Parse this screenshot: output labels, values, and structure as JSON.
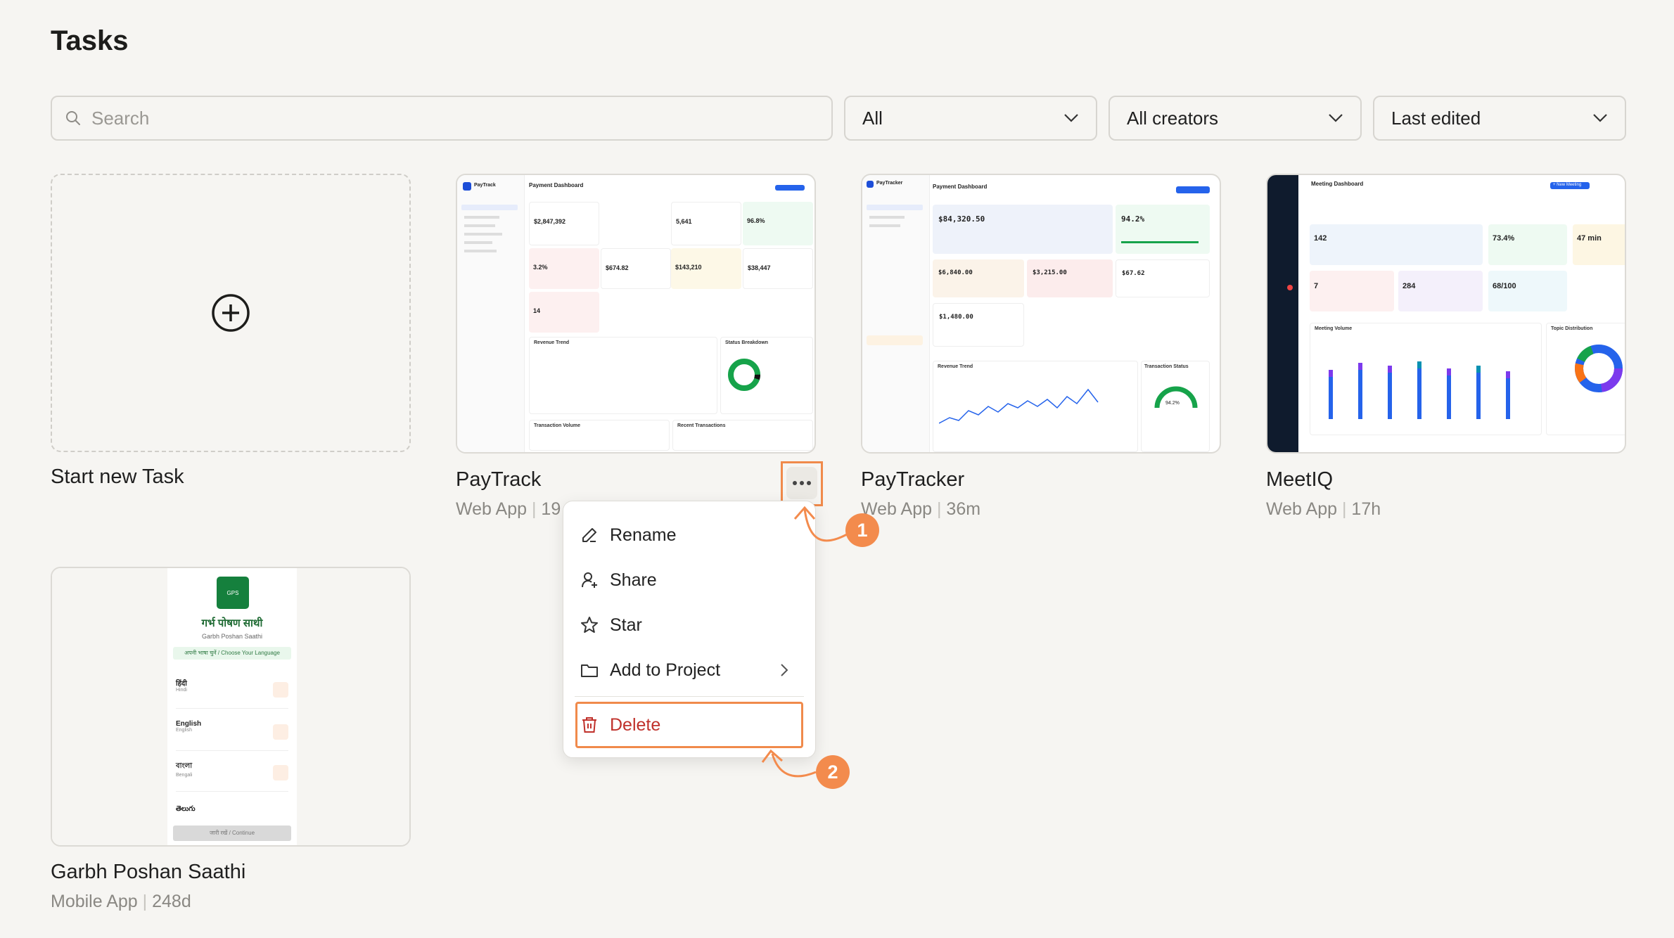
{
  "page": {
    "title": "Tasks"
  },
  "search": {
    "placeholder": "Search"
  },
  "filters": [
    {
      "label": "All"
    },
    {
      "label": "All creators"
    },
    {
      "label": "Last edited"
    }
  ],
  "new_task": {
    "label": "Start new Task"
  },
  "projects": [
    {
      "name": "PayTrack",
      "type": "Web App",
      "age": "19"
    },
    {
      "name": "PayTracker",
      "type": "Web App",
      "age": "36m"
    },
    {
      "name": "MeetIQ",
      "type": "Web App",
      "age": "17h"
    },
    {
      "name": "Garbh Poshan Saathi",
      "type": "Mobile App",
      "age": "248d"
    }
  ],
  "meta_separator": "|",
  "context_menu": {
    "items": [
      "Rename",
      "Share",
      "Star",
      "Add to Project"
    ],
    "delete": "Delete"
  },
  "annotations": {
    "step1": "1",
    "step2": "2"
  },
  "thumbs": {
    "paytrack": {
      "header": "Payment Dashboard",
      "brand": "PayTrack",
      "values": [
        "$2,847,392",
        "5,641",
        "96.8%",
        "3.2%",
        "$674.82",
        "$143,210",
        "$38,447",
        "14"
      ],
      "sections": [
        "Revenue Trend",
        "Status Breakdown",
        "Transaction Volume",
        "Recent Transactions"
      ]
    },
    "paytracker": {
      "header": "Payment Dashboard",
      "brand": "PayTracker",
      "values": [
        "$84,320.50",
        "94.2%",
        "$6,840.00",
        "$3,215.00",
        "$67.62",
        "$1,480.00",
        "94.2%"
      ],
      "sections": [
        "Revenue Trend",
        "Transaction Status"
      ]
    },
    "meetiq": {
      "header": "Meeting Dashboard",
      "button": "+ New Meeting",
      "values": [
        "142",
        "73.4%",
        "47 min",
        "7",
        "284",
        "68/100"
      ],
      "sections": [
        "Meeting Volume",
        "Topic Distribution"
      ]
    },
    "garbh": {
      "title": "गर्भ पोषण साथी",
      "subtitle": "Garbh Poshan Saathi",
      "lang_banner": "अपनी भाषा चुनें / Choose Your Language",
      "languages": [
        {
          "native": "हिंदी",
          "english": "Hindi"
        },
        {
          "native": "English",
          "english": "English"
        },
        {
          "native": "বাংলা",
          "english": "Bengali"
        },
        {
          "native": "తెలుగు",
          "english": ""
        }
      ],
      "continue": "जारी रखें / Continue",
      "logo": "GPS"
    }
  },
  "colors": {
    "accent": "#f38b4d",
    "delete": "#c0312b",
    "green": "#1f8a3a"
  }
}
